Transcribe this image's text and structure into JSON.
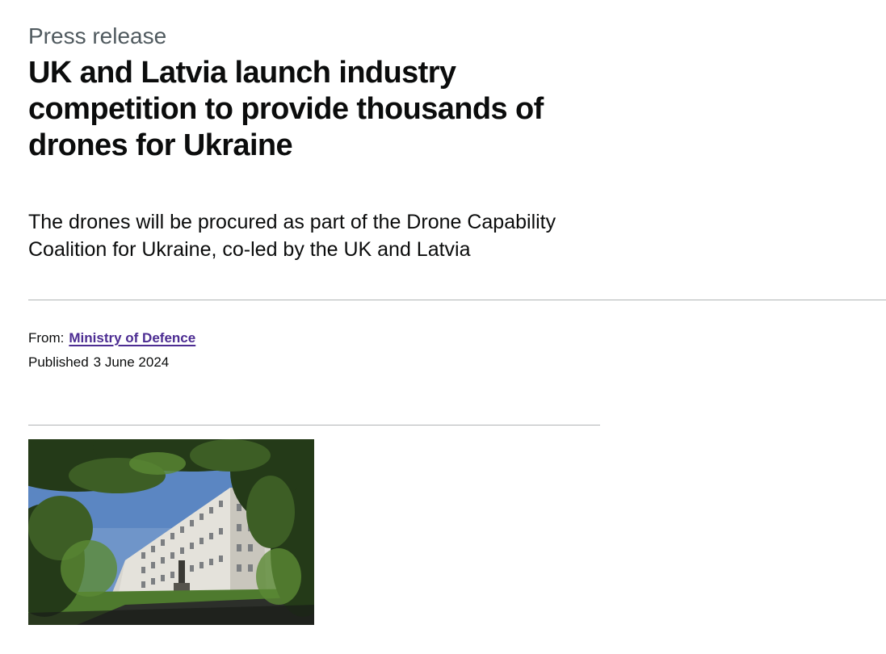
{
  "header": {
    "caption": "Press release",
    "title": "UK and Latvia launch industry competition to provide thousands of drones for Ukraine"
  },
  "lead": "The drones will be procured as part of the Drone Capability Coalition for Ukraine, co-led by the UK and Latvia",
  "metadata": {
    "from_label": "From:",
    "from_org": "Ministry of Defence",
    "published_label": "Published",
    "published_date": "3 June 2024"
  },
  "colors": {
    "link": "#4c2c92",
    "caption": "#505a5f",
    "text": "#0b0c0c",
    "rule": "#b1b4b6"
  }
}
